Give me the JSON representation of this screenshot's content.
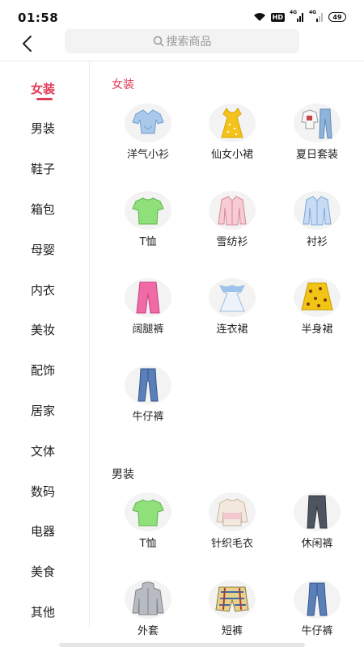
{
  "status_bar": {
    "time": "01:58",
    "hd_label": "HD",
    "sim1_label": "4G",
    "sim2_label": "4G",
    "battery": "49"
  },
  "header": {
    "back_icon": "chevron-left-icon",
    "search_icon": "search-icon",
    "search_placeholder": "搜索商品"
  },
  "theme": {
    "accent_color": "#e23a55",
    "thumb_bg": "#f3f3f3",
    "divider": "#ececec"
  },
  "sidebar": {
    "active_index": 0,
    "items": [
      {
        "label": "女装"
      },
      {
        "label": "男装"
      },
      {
        "label": "鞋子"
      },
      {
        "label": "箱包"
      },
      {
        "label": "母婴"
      },
      {
        "label": "内衣"
      },
      {
        "label": "美妆"
      },
      {
        "label": "配饰"
      },
      {
        "label": "居家"
      },
      {
        "label": "文体"
      },
      {
        "label": "数码"
      },
      {
        "label": "电器"
      },
      {
        "label": "美食"
      },
      {
        "label": "其他"
      }
    ]
  },
  "sections": [
    {
      "title": "女装",
      "items": [
        {
          "label": "洋气小衫",
          "icon": "blouse-icon"
        },
        {
          "label": "仙女小裙",
          "icon": "dress-icon"
        },
        {
          "label": "夏日套装",
          "icon": "summer-set-icon"
        },
        {
          "label": "T恤",
          "icon": "tshirt-icon"
        },
        {
          "label": "雪纺衫",
          "icon": "chiffon-shirt-icon"
        },
        {
          "label": "衬衫",
          "icon": "shirt-icon"
        },
        {
          "label": "阔腿裤",
          "icon": "wide-pants-icon"
        },
        {
          "label": "连衣裙",
          "icon": "one-piece-dress-icon"
        },
        {
          "label": "半身裙",
          "icon": "skirt-icon"
        },
        {
          "label": "牛仔裤",
          "icon": "jeans-icon"
        }
      ]
    },
    {
      "title": "男装",
      "items": [
        {
          "label": "T恤",
          "icon": "tshirt-icon"
        },
        {
          "label": "针织毛衣",
          "icon": "sweater-icon"
        },
        {
          "label": "休闲裤",
          "icon": "casual-pants-icon"
        },
        {
          "label": "外套",
          "icon": "jacket-icon"
        },
        {
          "label": "短裤",
          "icon": "shorts-icon"
        },
        {
          "label": "牛仔裤",
          "icon": "jeans-icon"
        }
      ]
    }
  ]
}
